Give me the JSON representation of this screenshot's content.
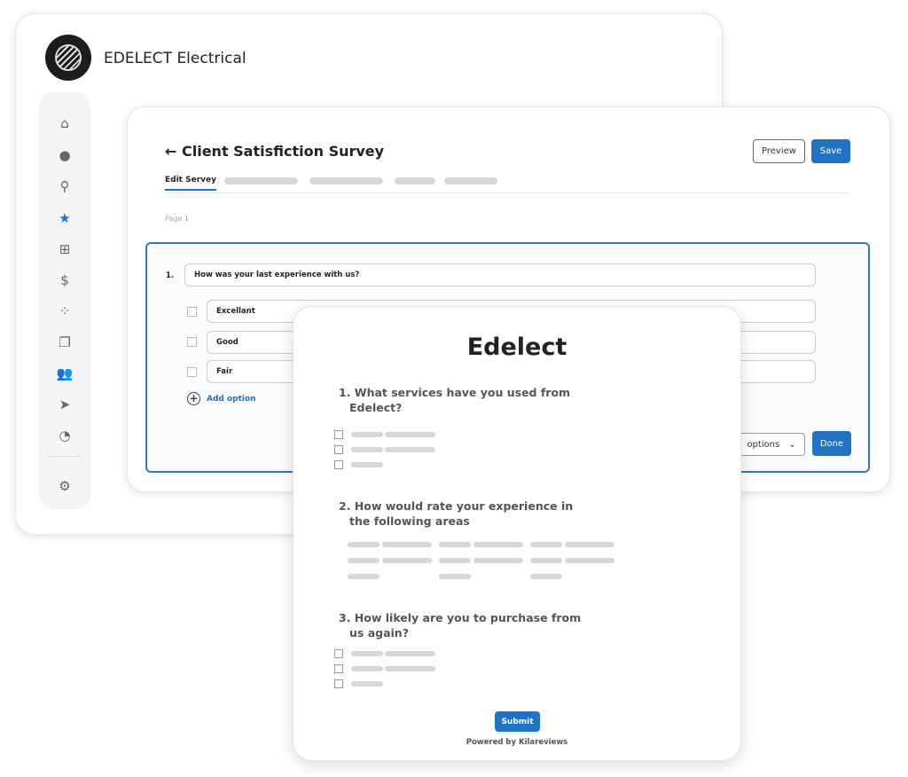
{
  "app": {
    "brand": "EDELECT Electrical"
  },
  "sidebar": {
    "items": [
      {
        "icon": "home-icon",
        "glyph": "⌂"
      },
      {
        "icon": "chat-icon",
        "glyph": "●"
      },
      {
        "icon": "location-pin-icon",
        "glyph": "⚲"
      },
      {
        "icon": "star-icon",
        "glyph": "★",
        "active": true
      },
      {
        "icon": "grid-icon",
        "glyph": "⊞"
      },
      {
        "icon": "dollar-icon",
        "glyph": "$"
      },
      {
        "icon": "nodes-icon",
        "glyph": "⁘"
      },
      {
        "icon": "copy-icon",
        "glyph": "❐"
      },
      {
        "icon": "users-icon",
        "glyph": "👥"
      },
      {
        "icon": "send-icon",
        "glyph": "➤"
      },
      {
        "icon": "pie-chart-icon",
        "glyph": "◔"
      }
    ],
    "settings": {
      "icon": "gear-icon",
      "glyph": "⚙"
    }
  },
  "editor": {
    "back_glyph": "←",
    "title": "Client Satisfiction Survey",
    "preview_label": "Preview",
    "save_label": "Save",
    "active_tab": "Edit Servey",
    "page_label": "Page 1",
    "question": {
      "number": "1.",
      "text": "How was your last experience with us?",
      "options": [
        "Excellant",
        "Good",
        "Fair"
      ]
    },
    "add_option_label": "Add option",
    "options_dropdown": "options",
    "done_label": "Done"
  },
  "preview": {
    "title": "Edelect",
    "questions": [
      "1. What services have you used from Edelect?",
      "2. How would rate your experience in the following areas",
      "3. How likely are you to purchase from us again?"
    ],
    "submit_label": "Submit",
    "powered_by": "Powered by Kilareviews"
  },
  "colors": {
    "accent": "#1f73c4"
  }
}
